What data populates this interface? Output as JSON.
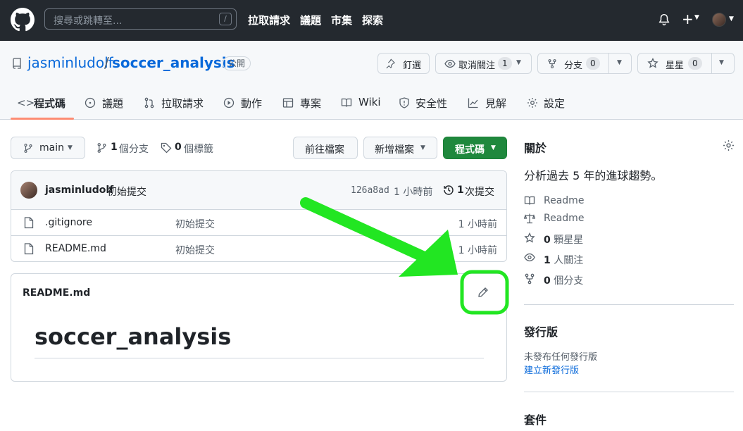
{
  "header": {
    "search_placeholder": "搜尋或跳轉至...",
    "slash_key": "/",
    "nav": [
      "拉取請求",
      "議題",
      "市集",
      "探索"
    ]
  },
  "repo": {
    "owner": "jasminludolf",
    "separator": "/",
    "name": "soccer_analysis",
    "visibility": "公開",
    "pin_label": "釘選",
    "watch_label": "取消關注",
    "watch_count": "1",
    "fork_label": "分支",
    "fork_count": "0",
    "star_label": "星星",
    "star_count": "0"
  },
  "tabs": [
    {
      "label": "程式碼",
      "icon": "code-icon"
    },
    {
      "label": "議題",
      "icon": "issue-icon"
    },
    {
      "label": "拉取請求",
      "icon": "pull-request-icon"
    },
    {
      "label": "動作",
      "icon": "play-icon"
    },
    {
      "label": "專案",
      "icon": "table-icon"
    },
    {
      "label": "Wiki",
      "icon": "book-icon"
    },
    {
      "label": "安全性",
      "icon": "shield-icon"
    },
    {
      "label": "見解",
      "icon": "graph-icon"
    },
    {
      "label": "設定",
      "icon": "gear-icon"
    }
  ],
  "toolbar": {
    "branch": "main",
    "branch_count": "1",
    "branch_label": "個分支",
    "tag_count": "0",
    "tag_label": "個標籤",
    "goto_file": "前往檔案",
    "add_file": "新增檔案",
    "code": "程式碼"
  },
  "commit": {
    "author": "jasminludolf",
    "message": "初始提交",
    "sha": "126a8ad",
    "time": "1 小時前",
    "count": "1",
    "count_label": "次提交"
  },
  "files": [
    {
      "name": ".gitignore",
      "message": "初始提交",
      "time": "1 小時前"
    },
    {
      "name": "README.md",
      "message": "初始提交",
      "time": "1 小時前"
    }
  ],
  "readme": {
    "filename": "README.md",
    "heading": "soccer_analysis"
  },
  "about": {
    "title": "關於",
    "description": "分析過去 5 年的進球趨勢。",
    "readme": "Readme",
    "license": "Readme",
    "stars_count": "0",
    "stars_label": "顆星星",
    "watchers_count": "1",
    "watchers_label": "人關注",
    "forks_count": "0",
    "forks_label": "個分支"
  },
  "releases": {
    "title": "發行版",
    "none": "未發布任何發行版",
    "create": "建立新發行版"
  },
  "packages": {
    "title": "套件"
  },
  "colors": {
    "header_bg": "#24292f",
    "link": "#0969da",
    "green_button": "#1f883d",
    "annotation": "#22e622",
    "tab_underline": "#fd8c73"
  }
}
